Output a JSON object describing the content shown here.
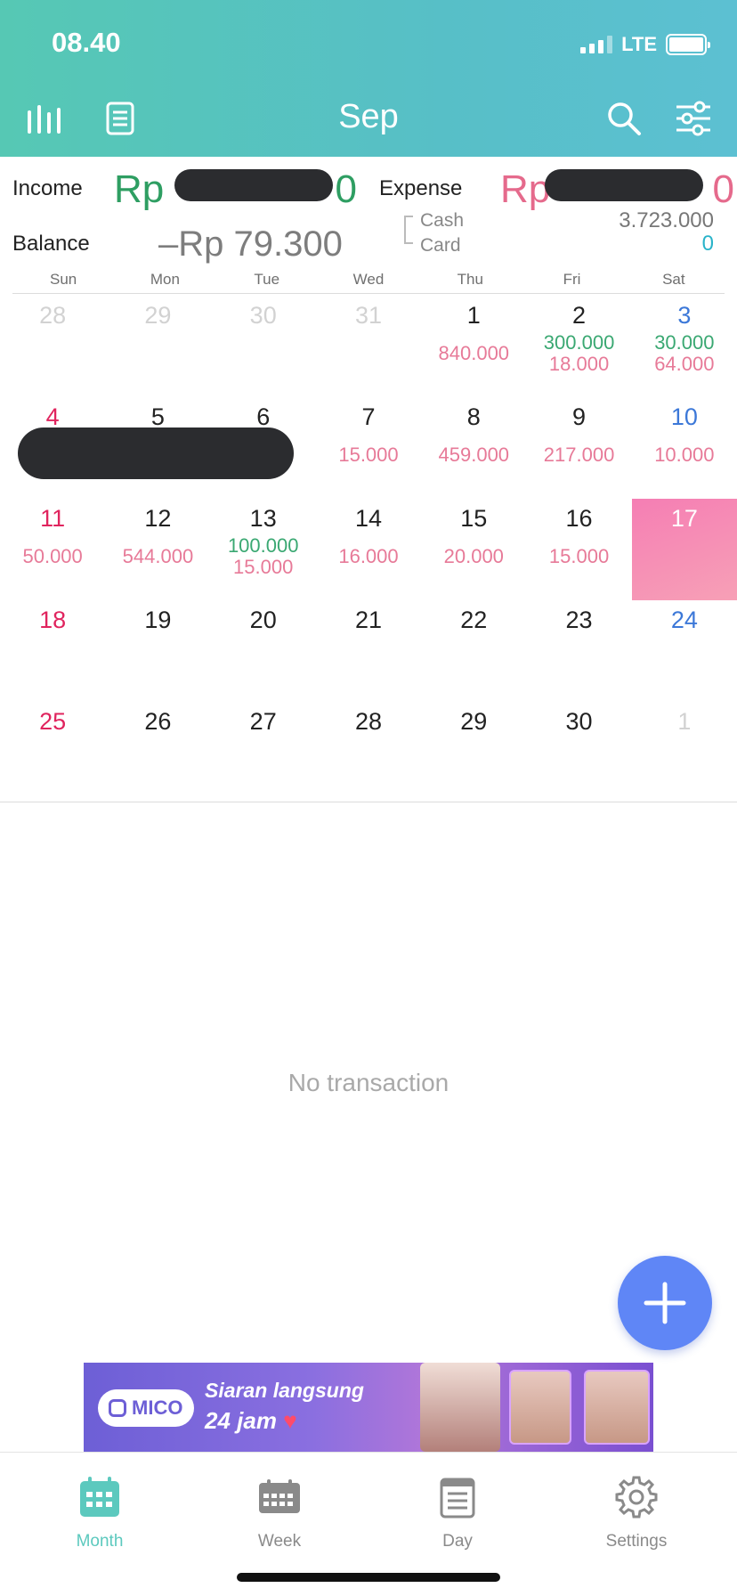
{
  "status_bar": {
    "time": "08.40",
    "network": "LTE"
  },
  "header": {
    "month": "Sep",
    "icons": [
      "stats-icon",
      "list-icon",
      "search-icon",
      "filter-icon"
    ],
    "gradient": [
      "#56c8b4",
      "#5cc0d2"
    ]
  },
  "summary": {
    "income_label": "Income",
    "income_prefix": "Rp",
    "income_tail": "0",
    "expense_label": "Expense",
    "expense_prefix": "Rp",
    "expense_tail": "0",
    "balance_label": "Balance",
    "balance_value": "–Rp 79.300",
    "cash_label": "Cash",
    "card_label": "Card",
    "cash_value": "3.723.000",
    "card_value": "0",
    "income_color": "#2e9e62",
    "expense_color": "#e56a8c"
  },
  "weekdays": [
    "Sun",
    "Mon",
    "Tue",
    "Wed",
    "Thu",
    "Fri",
    "Sat"
  ],
  "calendar": [
    {
      "day": "28",
      "state": "prev"
    },
    {
      "day": "29",
      "state": "prev"
    },
    {
      "day": "30",
      "state": "prev"
    },
    {
      "day": "31",
      "state": "prev"
    },
    {
      "day": "1",
      "expense": "840.000"
    },
    {
      "day": "2",
      "income": "300.000",
      "expense": "18.000"
    },
    {
      "day": "3",
      "income": "30.000",
      "expense": "64.000"
    },
    {
      "day": "4"
    },
    {
      "day": "5"
    },
    {
      "day": "6"
    },
    {
      "day": "7",
      "expense": "15.000"
    },
    {
      "day": "8",
      "expense": "459.000"
    },
    {
      "day": "9",
      "expense": "217.000"
    },
    {
      "day": "10",
      "expense": "10.000"
    },
    {
      "day": "11",
      "expense": "50.000"
    },
    {
      "day": "12",
      "expense": "544.000"
    },
    {
      "day": "13",
      "income": "100.000",
      "expense": "15.000"
    },
    {
      "day": "14",
      "expense": "16.000"
    },
    {
      "day": "15",
      "expense": "20.000"
    },
    {
      "day": "16",
      "expense": "15.000"
    },
    {
      "day": "17",
      "state": "today"
    },
    {
      "day": "18"
    },
    {
      "day": "19"
    },
    {
      "day": "20"
    },
    {
      "day": "21"
    },
    {
      "day": "22"
    },
    {
      "day": "23"
    },
    {
      "day": "24"
    },
    {
      "day": "25"
    },
    {
      "day": "26"
    },
    {
      "day": "27"
    },
    {
      "day": "28"
    },
    {
      "day": "29"
    },
    {
      "day": "30"
    },
    {
      "day": "1",
      "state": "next"
    }
  ],
  "empty_state": "No transaction",
  "ad": {
    "brand": "MICO",
    "line1": "Siaran langsung",
    "line2": "24 jam"
  },
  "tabs": [
    {
      "label": "Month",
      "icon": "calendar-month-icon",
      "active": true
    },
    {
      "label": "Week",
      "icon": "calendar-week-icon",
      "active": false
    },
    {
      "label": "Day",
      "icon": "calendar-day-icon",
      "active": false
    },
    {
      "label": "Settings",
      "icon": "gear-icon",
      "active": false
    }
  ],
  "accent_color": "#5cc9be",
  "fab_color": "#5f86f6"
}
